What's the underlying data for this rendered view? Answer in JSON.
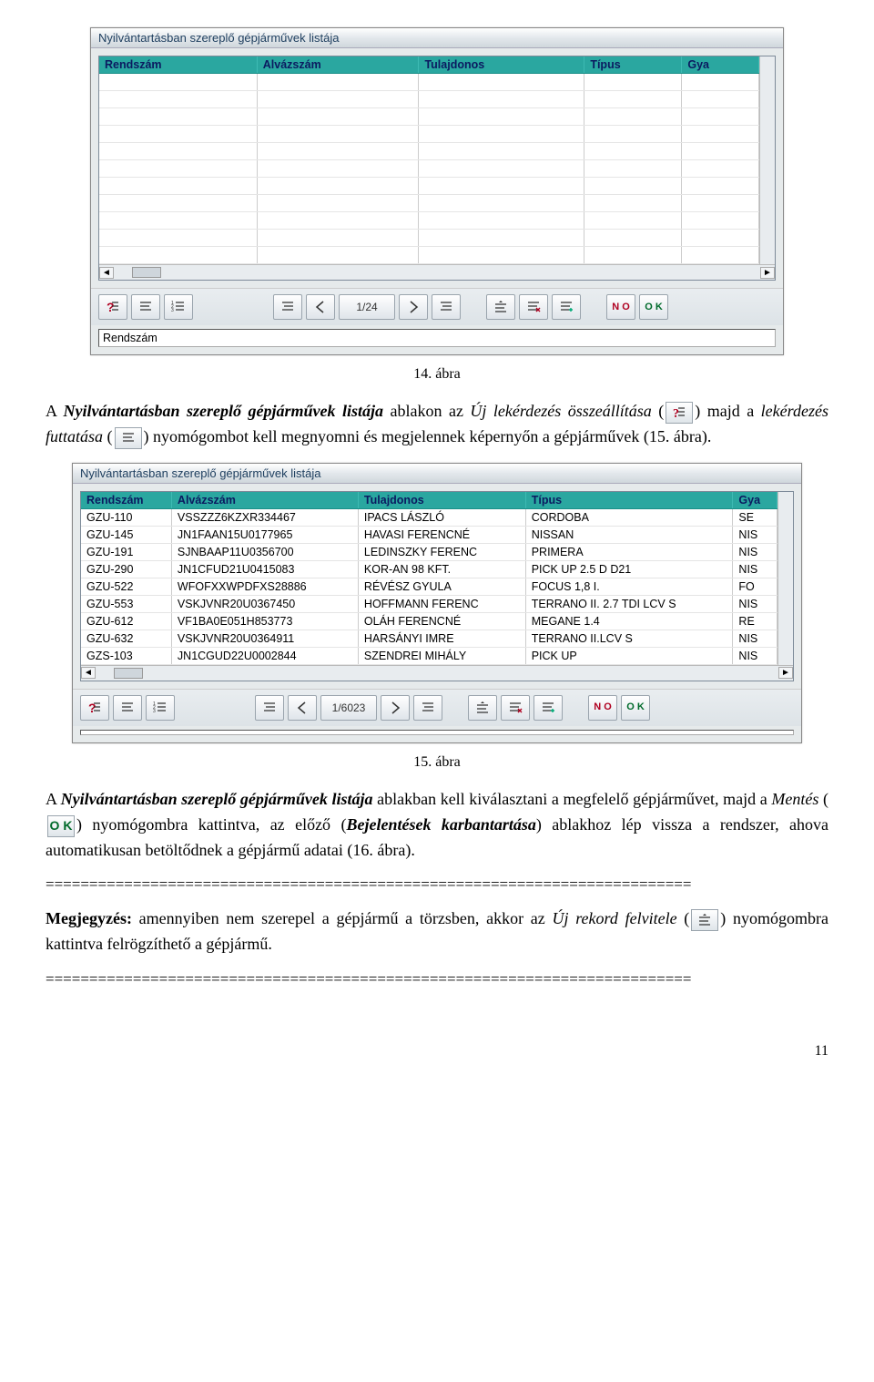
{
  "window_title": "Nyilvántartásban szereplő gépjárművek listája",
  "columns": [
    "Rendszám",
    "Alvázszám",
    "Tulajdonos",
    "Típus",
    "Gya"
  ],
  "empty_rows": 11,
  "counter1": "1/24",
  "footer_field1": "Rendszám",
  "caption1": "14. ábra",
  "para1_a": "A ",
  "para1_b": "Nyilvántartásban szereplő gépjárművek listája",
  "para1_c": " ablakon az ",
  "para1_d": "Új lekérdezés összeállítása",
  "para1_e": " (",
  "para1_f": ") majd a ",
  "para1_g": "lekérdezés futtatása",
  "para1_h": " (",
  "para1_i": ") nyomógombot kell megnyomni és megjelennek képernyőn a gépjárművek (15. ábra).",
  "rows2": [
    {
      "r": "GZU-110",
      "a": "VSSZZZ6KZXR334467",
      "t": "IPACS LÁSZLÓ",
      "tp": "CORDOBA",
      "g": "SE"
    },
    {
      "r": "GZU-145",
      "a": "JN1FAAN15U0177965",
      "t": "HAVASI FERENCNÉ",
      "tp": "NISSAN",
      "g": "NIS"
    },
    {
      "r": "GZU-191",
      "a": "SJNBAAP11U0356700",
      "t": "LEDINSZKY FERENC",
      "tp": "PRIMERA",
      "g": "NIS"
    },
    {
      "r": "GZU-290",
      "a": "JN1CFUD21U0415083",
      "t": "KOR-AN 98 KFT.",
      "tp": "PICK UP 2.5 D D21",
      "g": "NIS"
    },
    {
      "r": "GZU-522",
      "a": "WFOFXXWPDFXS28886",
      "t": "RÉVÉSZ GYULA",
      "tp": "FOCUS 1,8 I.",
      "g": "FO"
    },
    {
      "r": "GZU-553",
      "a": "VSKJVNR20U0367450",
      "t": "HOFFMANN FERENC",
      "tp": "TERRANO II. 2.7 TDI LCV S",
      "g": "NIS"
    },
    {
      "r": "GZU-612",
      "a": "VF1BA0E051H853773",
      "t": "OLÁH FERENCNÉ",
      "tp": "MEGANE 1.4",
      "g": "RE"
    },
    {
      "r": "GZU-632",
      "a": "VSKJVNR20U0364911",
      "t": "HARSÁNYI IMRE",
      "tp": "TERRANO II.LCV S",
      "g": "NIS"
    },
    {
      "r": "GZS-103",
      "a": "JN1CGUD22U0002844",
      "t": "SZENDREI MIHÁLY",
      "tp": "PICK UP",
      "g": "NIS"
    }
  ],
  "counter2": "1/6023",
  "footer_field2": "",
  "caption2": "15. ábra",
  "para2_a": "A ",
  "para2_b": "Nyilvántartásban szereplő gépjárművek listája",
  "para2_c": " ablakban kell kiválasztani a megfelelő gépjárművet, majd a ",
  "para2_d": "Mentés",
  "para2_e": " (",
  "para2_f": ") nyomógombra kattintva, az előző (",
  "para2_g": "Bejelentések karbantartása",
  "para2_h": ") ablakhoz lép vissza a rendszer, ahova automatikusan betöltődnek a gépjármű adatai (16. ábra).",
  "eqline": "==========================================================================",
  "note_label": "Megjegyzés:",
  "note_a": " amennyiben nem szerepel a gépjármű a törzsben, akkor az ",
  "note_b": "Új rekord felvitele",
  "note_c": " (",
  "note_d": ") nyomógombra kattintva felrögzíthető a gépjármű.",
  "pagenum": "11",
  "no_text": "N O",
  "ok_text": "O K"
}
